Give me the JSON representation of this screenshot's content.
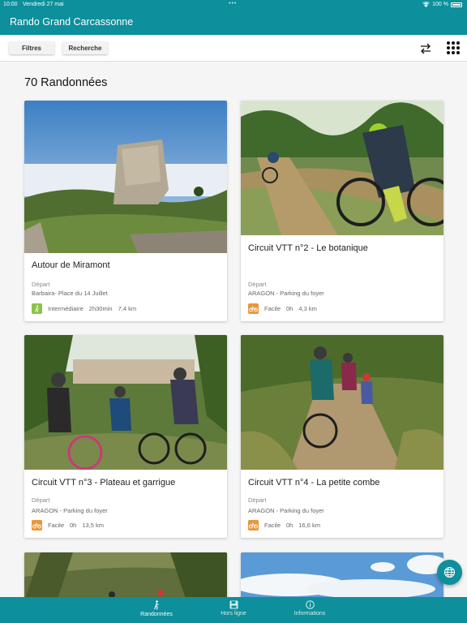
{
  "status": {
    "time": "10:00",
    "date": "Vendredi 27 mai",
    "battery": "100 %"
  },
  "app": {
    "title": "Rando Grand Carcassonne"
  },
  "toolbar": {
    "filters": "Filtres",
    "search": "Recherche"
  },
  "list": {
    "count": "70 Randonnées"
  },
  "cards": [
    {
      "title": "Autour de Miramont",
      "depart_label": "Départ",
      "depart": "Barbaira- Place du 14 Juillet",
      "difficulty": "Intermédiaire",
      "duration": "2h30min",
      "distance": "7,4 km",
      "difficulty_color": "#8bc34a",
      "icon": "hiker-icon"
    },
    {
      "title": "Circuit VTT n°2 - Le botanique",
      "depart_label": "Départ",
      "depart": "ARAGON - Parking du foyer",
      "difficulty": "Facile",
      "duration": "0h",
      "distance": "4,3 km",
      "difficulty_color": "#e8963a",
      "icon": "bike-icon"
    },
    {
      "title": "Circuit VTT n°3 - Plateau et garrigue",
      "depart_label": "Départ",
      "depart": "ARAGON - Parking du foyer",
      "difficulty": "Facile",
      "duration": "0h",
      "distance": "13,5 km",
      "difficulty_color": "#e8963a",
      "icon": "bike-icon"
    },
    {
      "title": "Circuit VTT n°4 - La petite combe",
      "depart_label": "Départ",
      "depart": "ARAGON - Parking du foyer",
      "difficulty": "Facile",
      "duration": "0h",
      "distance": "16,6 km",
      "difficulty_color": "#e8963a",
      "icon": "bike-icon"
    }
  ],
  "tabs": [
    {
      "label": "Randonnées",
      "icon": "hiker-icon"
    },
    {
      "label": "Hors ligne",
      "icon": "save-icon"
    },
    {
      "label": "Informations",
      "icon": "info-icon"
    }
  ],
  "colors": {
    "primary": "#0d8f9c",
    "easy": "#e8963a",
    "intermediate": "#8bc34a"
  }
}
